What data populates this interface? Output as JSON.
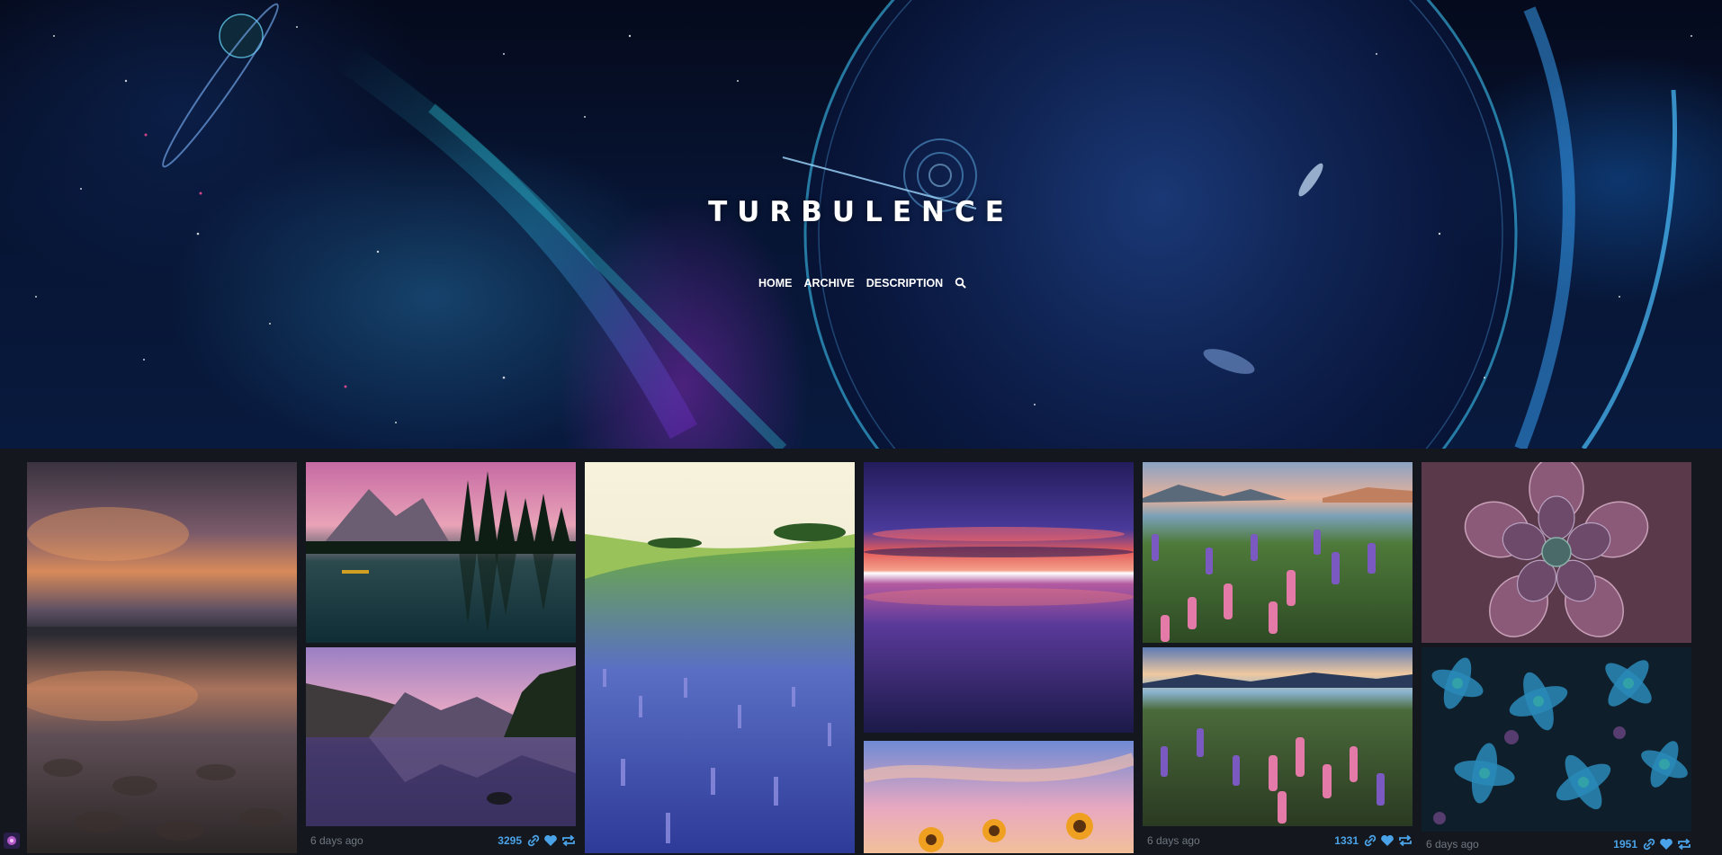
{
  "header": {
    "title": "TURBULENCE",
    "nav": {
      "home": "HOME",
      "archive": "ARCHIVE",
      "description": "DESCRIPTION",
      "search_icon": "search-icon"
    }
  },
  "posts": [
    {
      "image": "stormy sunset sky reflected on wet mud flats"
    },
    {
      "image": "pink sky over mountain lake with pine forest and canoe"
    },
    {
      "image": "purple dusk mountain lake reflection with small rock",
      "meta": {
        "date": "6 days ago",
        "notes": "3295"
      }
    },
    {
      "image": "meadow of blue lupine flowers on green hills"
    },
    {
      "image": "vivid red and purple sunset over calm sea"
    },
    {
      "image": "sunflowers against sunset sky"
    },
    {
      "image": "pink and purple lupines with lake and mountains"
    },
    {
      "image": "lupine field beside lake at sunset",
      "meta": {
        "date": "6 days ago",
        "notes": "1331"
      }
    },
    {
      "image": "purple succulent rosette close-up"
    },
    {
      "image": "blue and teal succulent leaves pattern",
      "meta": {
        "date": "6 days ago",
        "notes": "1951"
      }
    }
  ],
  "icons": {
    "link": "link-icon",
    "like": "heart-icon",
    "reblog": "reblog-icon",
    "badge": "avatar-icon"
  },
  "colors": {
    "page_background": "#14171d",
    "notes_accent": "#4aa3e8",
    "date_text": "#707883"
  }
}
